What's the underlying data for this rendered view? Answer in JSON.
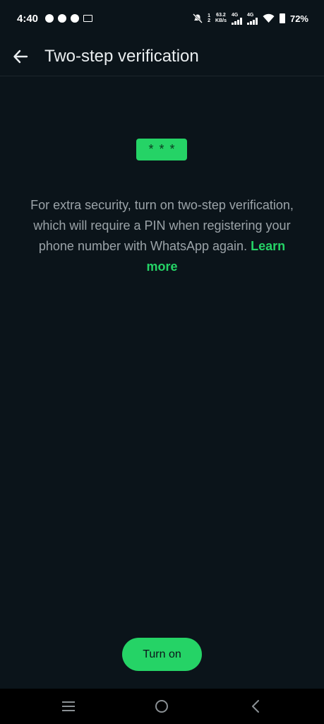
{
  "status_bar": {
    "time": "4:40",
    "net_speed_value": "63.2",
    "net_speed_unit": "KB/s",
    "sim1_label": "4G",
    "sim2_label": "4G",
    "call_sim_top": "1",
    "call_sim_bottom": "2",
    "battery": "72%"
  },
  "header": {
    "title": "Two-step verification"
  },
  "main": {
    "pin_mask": "***",
    "description": "For extra security, turn on two-step verification, which will require a PIN when registering your phone number with WhatsApp again.",
    "learn_more": "Learn more",
    "turn_on_label": "Turn on"
  },
  "colors": {
    "background": "#0b141a",
    "accent": "#25d366",
    "text_secondary": "#9ba3a8"
  },
  "icons": {
    "back": "arrow-left-icon",
    "nav_recents": "menu-lines-icon",
    "nav_home": "circle-icon",
    "nav_back": "chevron-left-icon"
  }
}
